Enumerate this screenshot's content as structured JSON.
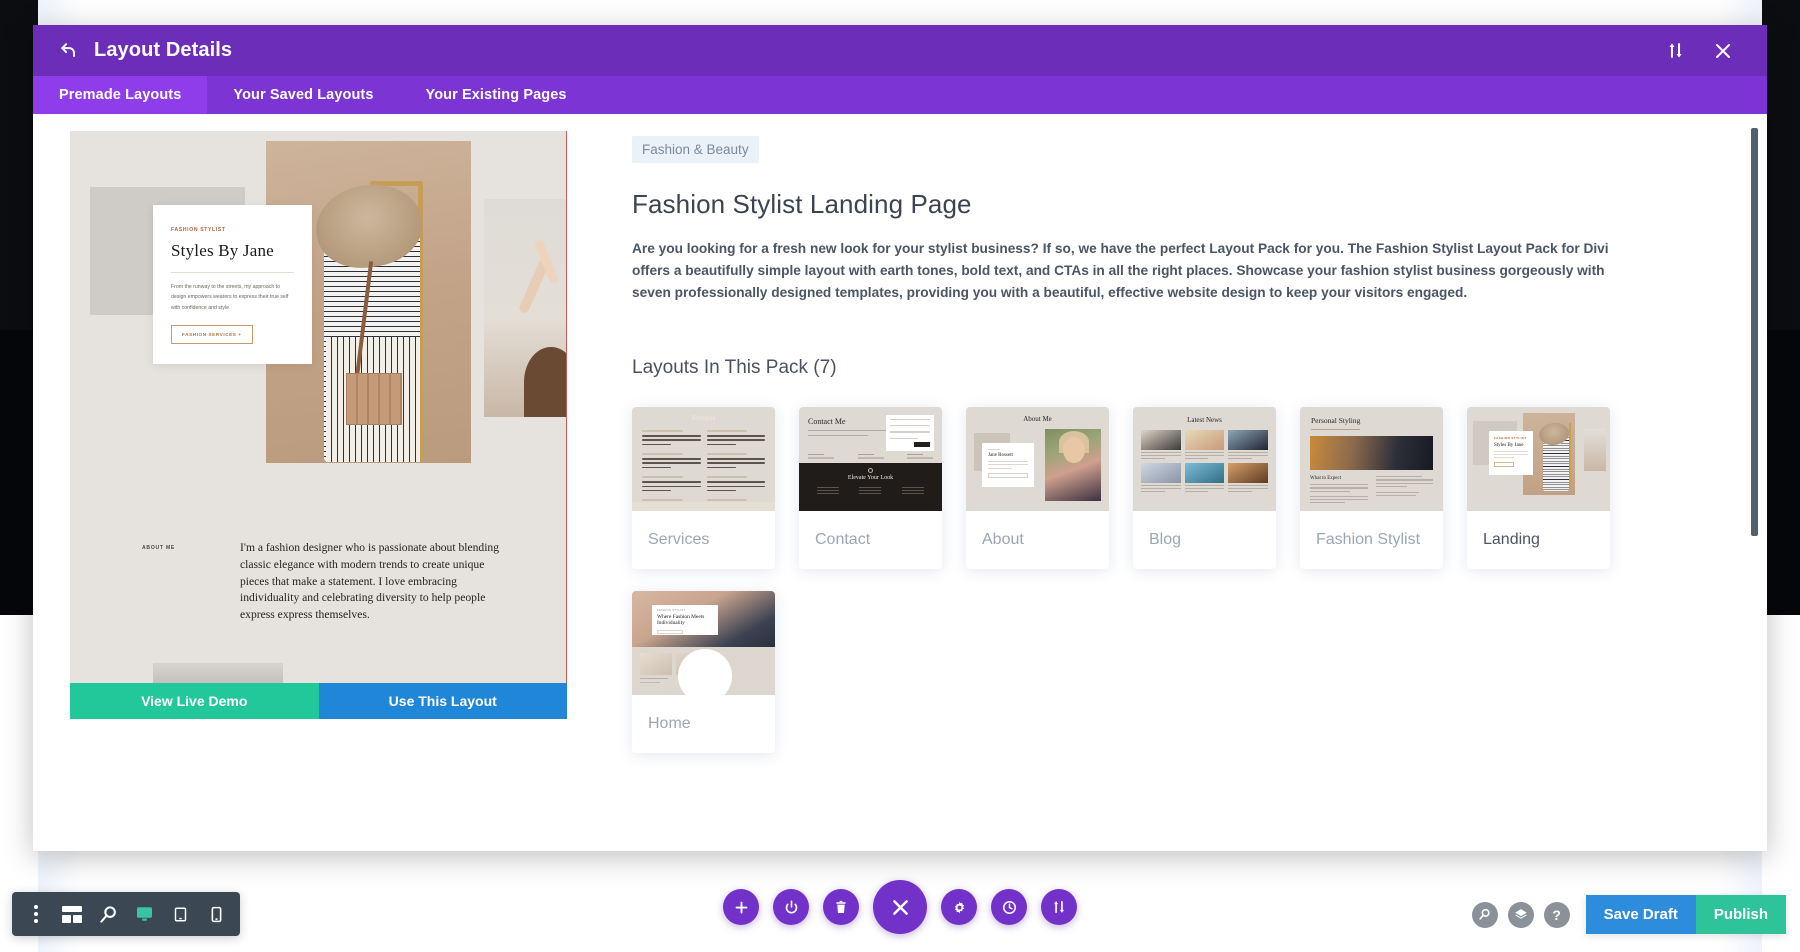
{
  "modal": {
    "header": {
      "back_icon": "back-arrow-icon",
      "title": "Layout Details",
      "sort_icon": "sort-updown-icon",
      "close_icon": "close-icon"
    },
    "tabs": [
      {
        "label": "Premade Layouts",
        "active": true
      },
      {
        "label": "Your Saved Layouts",
        "active": false
      },
      {
        "label": "Your Existing Pages",
        "active": false
      }
    ]
  },
  "preview": {
    "hero": {
      "eyebrow": "FASHION STYLIST",
      "title": "Styles By Jane",
      "body": "From the runway to the streets, my approach to design empowers wearers to express their true self with confidence and style",
      "cta": "FASHION SERVICES +"
    },
    "about": {
      "label": "ABOUT ME",
      "body": "I'm a fashion designer who is passionate about blending classic elegance with modern trends to create unique pieces that make a statement. I love embracing individuality and celebrating diversity to help people express express themselves."
    },
    "actions": {
      "demo_label": "View Live Demo",
      "use_label": "Use This Layout"
    }
  },
  "detail": {
    "category": "Fashion & Beauty",
    "title": "Fashion Stylist Landing Page",
    "description": "Are you looking for a fresh new look for your stylist business? If so, we have the perfect Layout Pack for you. The Fashion Stylist Layout Pack for Divi offers a beautifully simple layout with earth tones, bold text, and CTAs in all the right places. Showcase your fashion stylist business gorgeously with seven professionally designed templates, providing you with a beautiful, effective website design to keep your visitors engaged.",
    "pack_heading": "Layouts In This Pack (7)",
    "cards": [
      {
        "label": "Services",
        "thumb_title": "Services"
      },
      {
        "label": "Contact",
        "thumb_title": "Contact Me"
      },
      {
        "label": "About",
        "thumb_title": "About Me"
      },
      {
        "label": "Blog",
        "thumb_title": "Latest News"
      },
      {
        "label": "Fashion Stylist",
        "thumb_title": "Personal Styling"
      },
      {
        "label": "Landing",
        "thumb_title": "Styles By Jane"
      },
      {
        "label": "Home",
        "thumb_title": "Where Fashion Meets Individuality"
      }
    ],
    "thumb_text": {
      "contact_dark_title": "Elevate Your Look",
      "about_card_name": "Jane Rossett",
      "stylist_section": "What to Expect",
      "home_eyebrow": "FASHION STYLIST",
      "landing_eyebrow": "FASHION STYLIST"
    }
  },
  "left_toolbar": [
    {
      "icon": "kebab-menu-icon",
      "label": "More options",
      "active": false
    },
    {
      "icon": "wireframe-icon",
      "label": "Wireframe view",
      "active": false
    },
    {
      "icon": "zoom-out-icon",
      "label": "Zoom out",
      "active": false
    },
    {
      "icon": "desktop-icon",
      "label": "Desktop view",
      "active": true
    },
    {
      "icon": "tablet-icon",
      "label": "Tablet view",
      "active": false
    },
    {
      "icon": "phone-icon",
      "label": "Phone view",
      "active": false
    }
  ],
  "center_toolbar": [
    {
      "icon": "plus-icon",
      "label": "Add",
      "big": false
    },
    {
      "icon": "power-icon",
      "label": "Toggle",
      "big": false
    },
    {
      "icon": "trash-icon",
      "label": "Delete",
      "big": false
    },
    {
      "icon": "close-x-icon",
      "label": "Close menu",
      "big": true
    },
    {
      "icon": "gear-icon",
      "label": "Settings",
      "big": false
    },
    {
      "icon": "history-icon",
      "label": "Editing history",
      "big": false
    },
    {
      "icon": "portability-icon",
      "label": "Portability",
      "big": false
    }
  ],
  "right_toolbar": {
    "icons": [
      {
        "icon": "search-icon",
        "label": "Search"
      },
      {
        "icon": "layers-icon",
        "label": "Layers"
      },
      {
        "icon": "help-icon",
        "label": "Help"
      }
    ],
    "save_draft_label": "Save Draft",
    "publish_label": "Publish"
  },
  "colors": {
    "header_purple": "#6c2eb9",
    "tab_bar_purple": "#7c34d4",
    "tab_active_purple": "#8f3ceb",
    "demo_green": "#22c79a",
    "use_blue": "#1f86d8",
    "publish_green": "#2fc39a",
    "save_blue": "#2d8cdb",
    "toolbar_slate": "#3c4754",
    "accent_teal": "#39c3a3"
  }
}
